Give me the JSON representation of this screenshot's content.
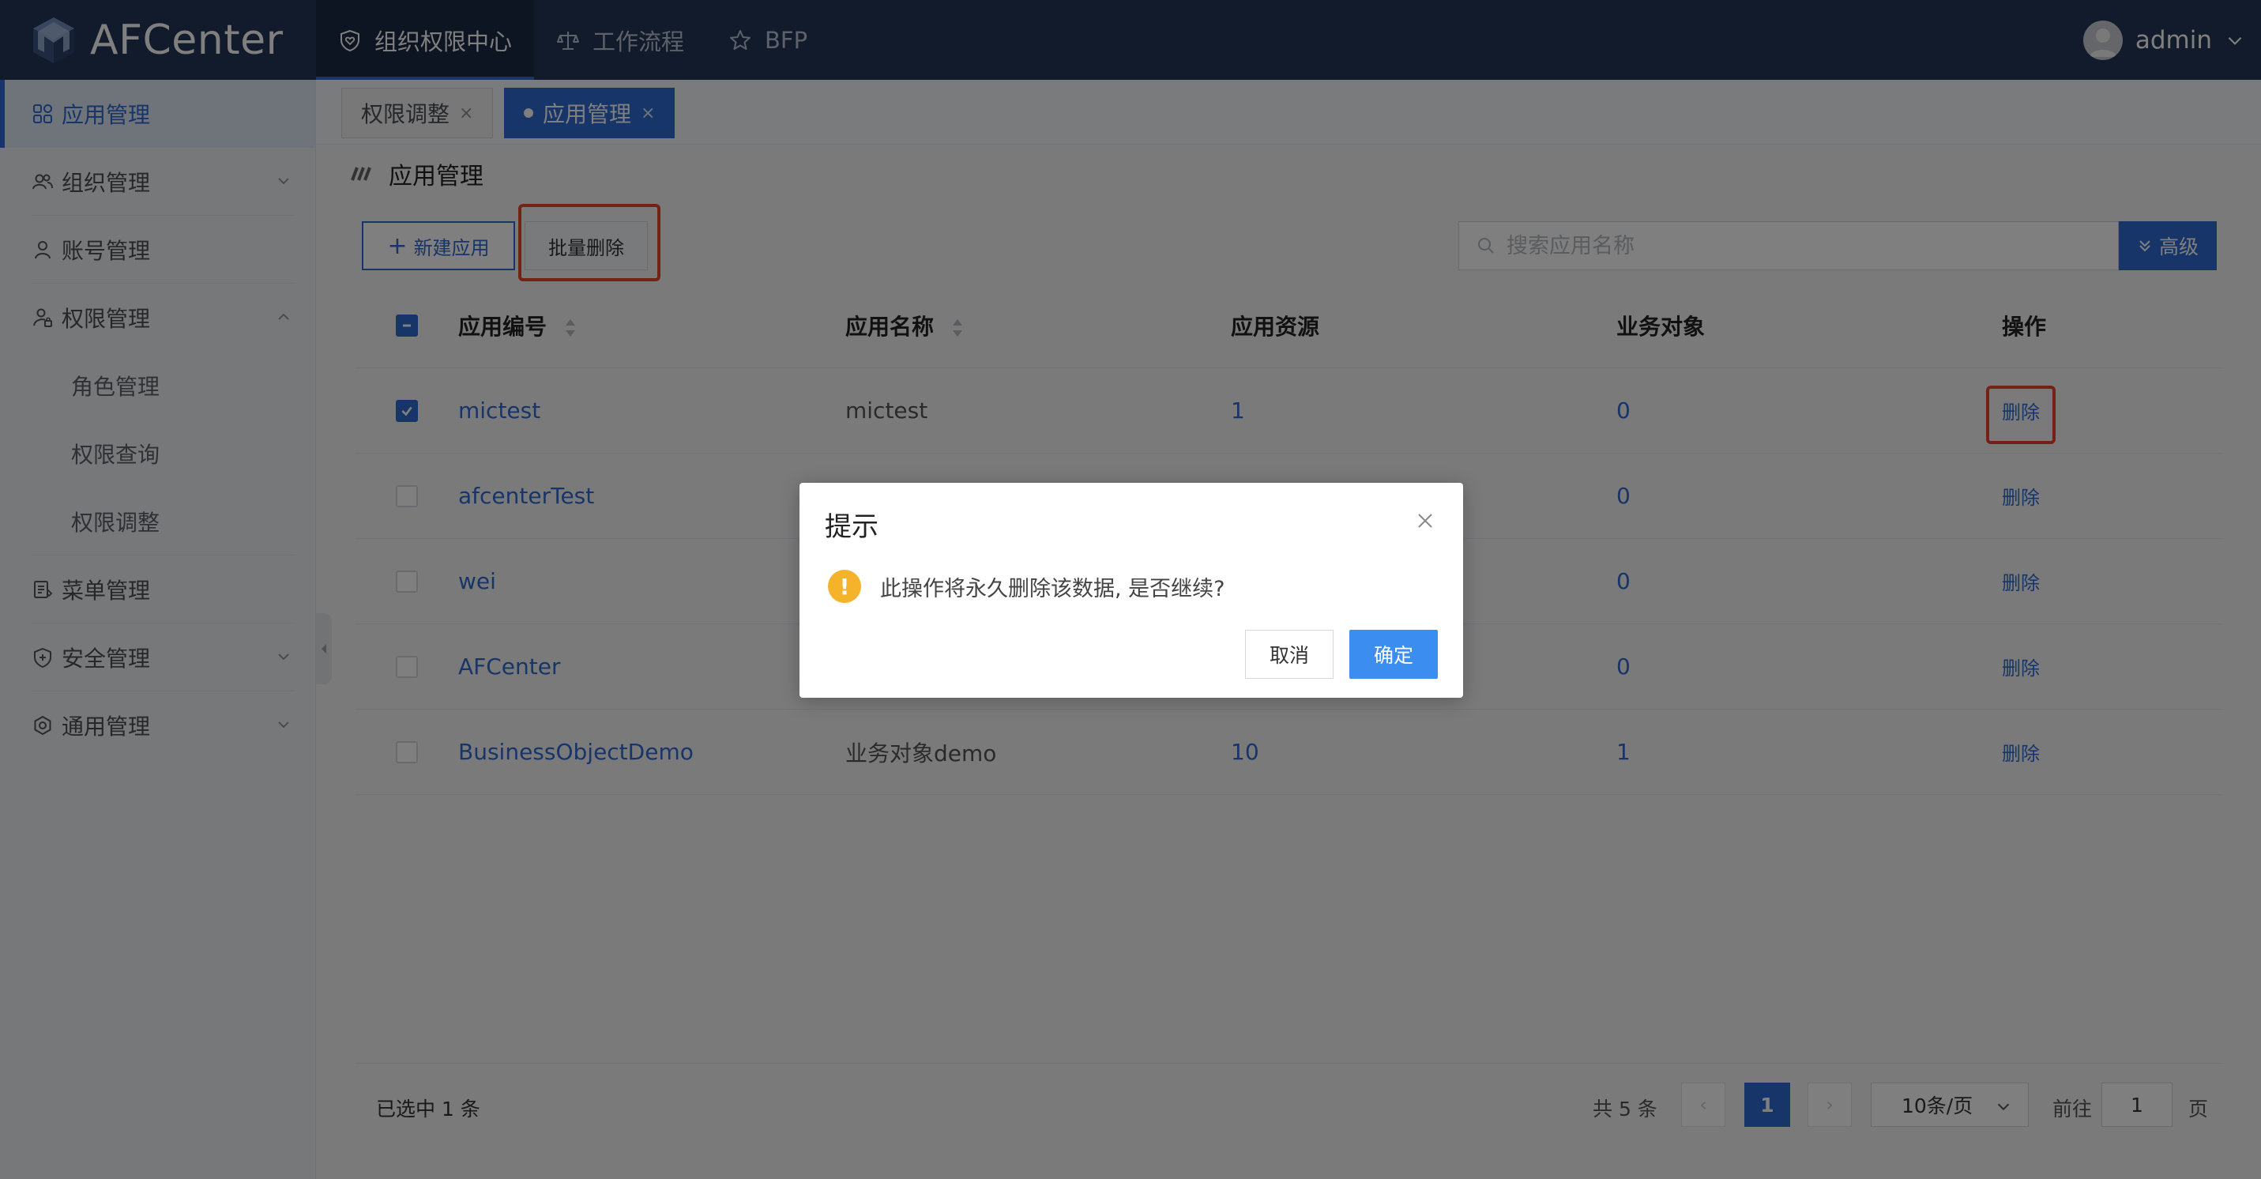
{
  "app": {
    "brand": "AFCenter",
    "user": "admin"
  },
  "topnav": [
    {
      "label": "组织权限中心",
      "icon": "shield-heart-icon",
      "active": true
    },
    {
      "label": "工作流程",
      "icon": "scale-icon",
      "active": false
    },
    {
      "label": "BFP",
      "icon": "star-icon",
      "active": false
    }
  ],
  "sidebar": {
    "items": [
      {
        "label": "应用管理",
        "icon": "grid-icon"
      },
      {
        "label": "组织管理",
        "icon": "users-icon"
      },
      {
        "label": "账号管理",
        "icon": "user-icon"
      },
      {
        "label": "权限管理",
        "icon": "user-lock-icon"
      },
      {
        "label": "角色管理"
      },
      {
        "label": "权限查询"
      },
      {
        "label": "权限调整"
      },
      {
        "label": "菜单管理",
        "icon": "menu-doc-icon"
      },
      {
        "label": "安全管理",
        "icon": "shield-plus-icon"
      },
      {
        "label": "通用管理",
        "icon": "settings-icon"
      }
    ]
  },
  "tabs": [
    {
      "label": "权限调整",
      "close": "×"
    },
    {
      "label": "应用管理",
      "close": "×"
    }
  ],
  "page": {
    "title": "应用管理"
  },
  "toolbar": {
    "new_label": "新建应用",
    "new_plus": "+",
    "batch_delete_label": "批量删除",
    "search_placeholder": "搜索应用名称",
    "advanced_label": "高级"
  },
  "table": {
    "headers": [
      "应用编号",
      "应用名称",
      "应用资源",
      "业务对象",
      "操作"
    ],
    "rows": [
      {
        "code": "mictest",
        "name": "mictest",
        "resources": "1",
        "objects": "0",
        "action": "删除",
        "checked": true
      },
      {
        "code": "afcenterTest",
        "name": "",
        "resources": "",
        "objects": "0",
        "action": "删除",
        "checked": false
      },
      {
        "code": "wei",
        "name": "",
        "resources": "",
        "objects": "0",
        "action": "删除",
        "checked": false
      },
      {
        "code": "AFCenter",
        "name": "",
        "resources": "",
        "objects": "0",
        "action": "删除",
        "checked": false
      },
      {
        "code": "BusinessObjectDemo",
        "name": "业务对象demo",
        "resources": "10",
        "objects": "1",
        "action": "删除",
        "checked": false
      }
    ]
  },
  "footer": {
    "selected_text": "已选中 1 条",
    "total_text": "共 5 条",
    "prev": "‹",
    "next": "›",
    "current_page": "1",
    "page_size": "10条/页",
    "goto_label": "前往",
    "goto_value": "1",
    "goto_suffix": "页"
  },
  "dialog": {
    "title": "提示",
    "message": "此操作将永久删除该数据, 是否继续?",
    "warn_glyph": "!",
    "cancel_label": "取消",
    "confirm_label": "确定"
  },
  "colors": {
    "header_bg": "#243656",
    "primary": "#2f6ad0",
    "confirm": "#3c8df0",
    "warning": "#f5b32b",
    "highlight": "#e8432d"
  }
}
